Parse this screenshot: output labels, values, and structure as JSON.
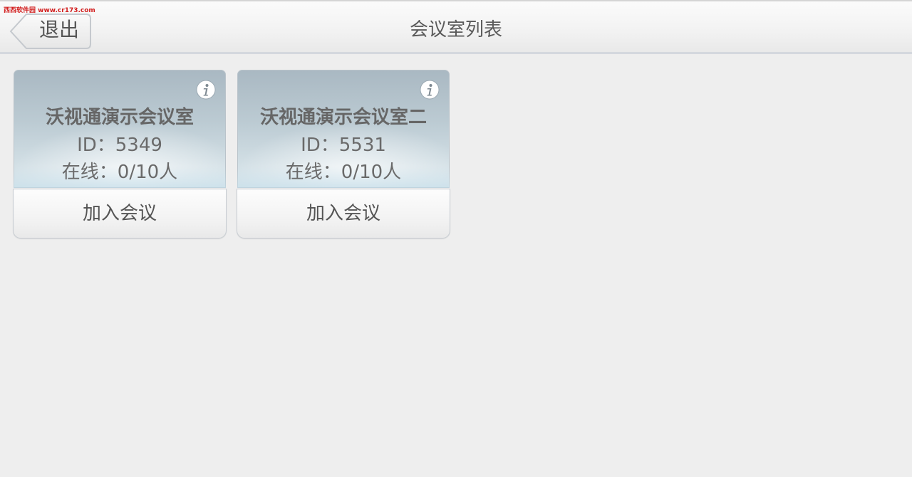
{
  "watermark": "西西软件园 www.cr173.com",
  "header": {
    "back_label": "退出",
    "title": "会议室列表"
  },
  "rooms": [
    {
      "name": "沃视通演示会议室",
      "id_text": "ID：5349",
      "online_text": "在线：0/10人",
      "join_label": "加入会议"
    },
    {
      "name": "沃视通演示会议室二",
      "id_text": "ID：5531",
      "online_text": "在线：0/10人",
      "join_label": "加入会议"
    }
  ],
  "icons": {
    "info": "info-icon",
    "back": "back-arrow-icon"
  },
  "colors": {
    "background": "#eeeeee",
    "text": "#666666",
    "card_top": "#bccbd3",
    "watermark": "#d21e1e"
  }
}
